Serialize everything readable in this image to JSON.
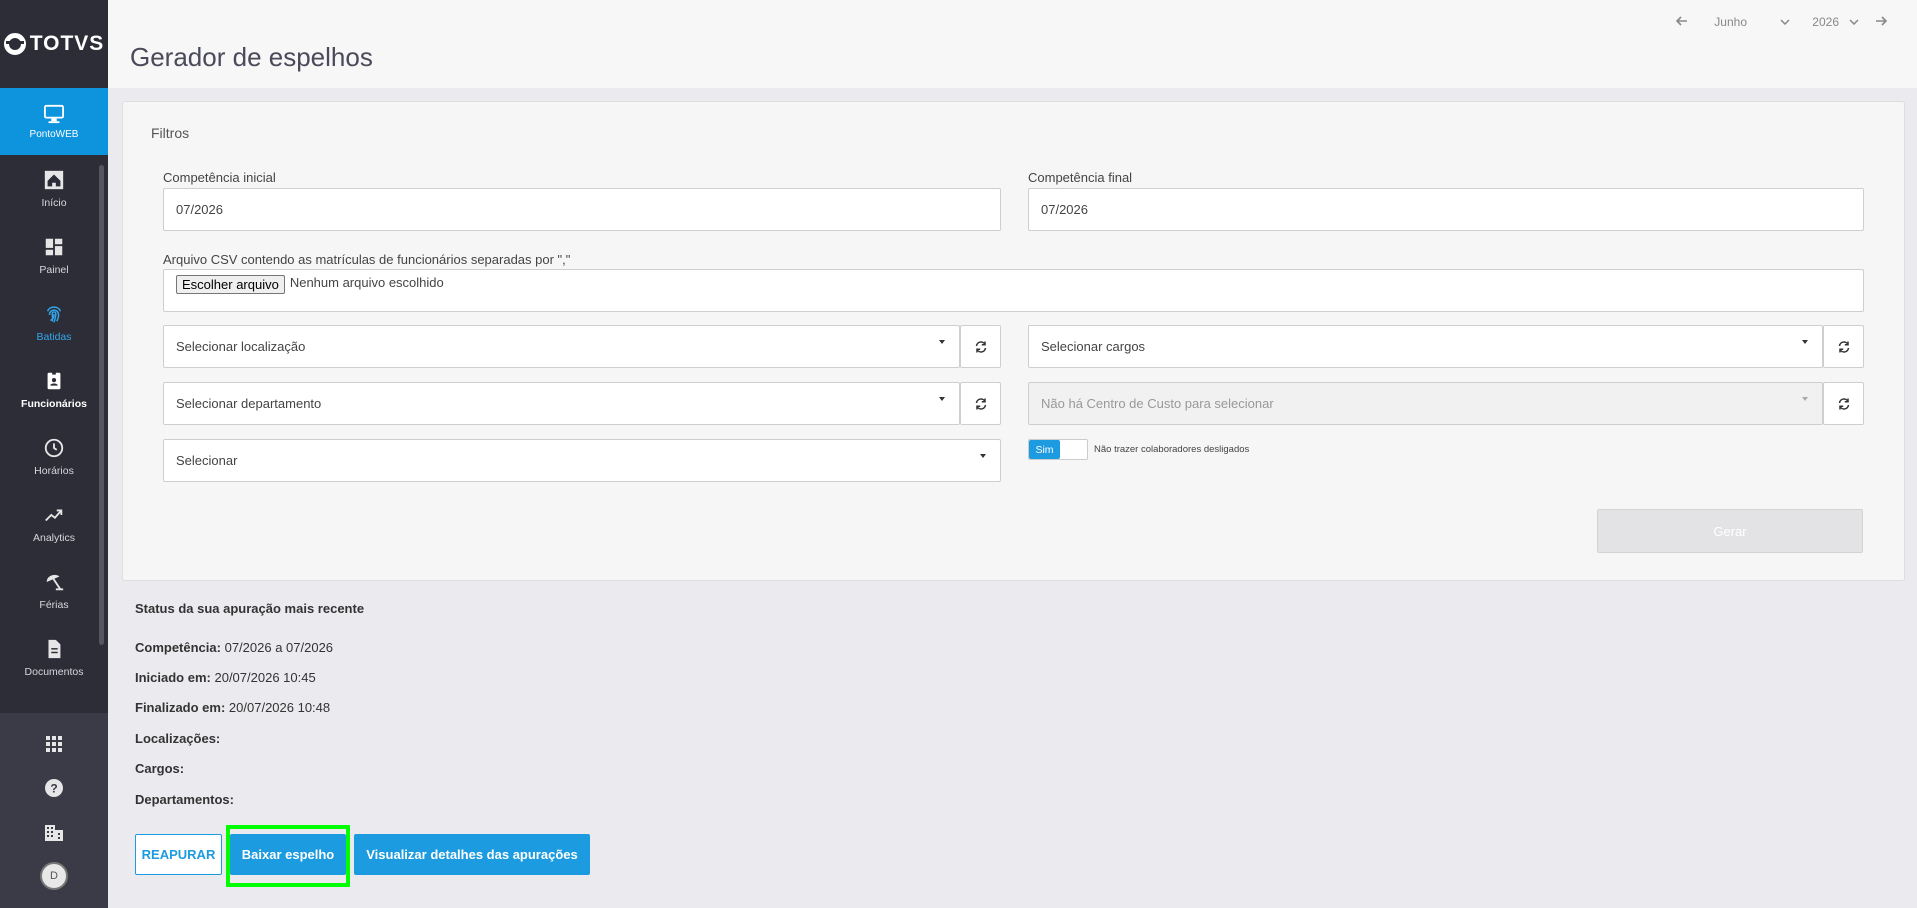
{
  "sidebar": {
    "logo": "TOTVS",
    "app_label": "PontoWEB",
    "items": [
      {
        "label": "Início",
        "icon": "home-icon"
      },
      {
        "label": "Painel",
        "icon": "dashboard-icon"
      },
      {
        "label": "Batidas",
        "icon": "fingerprint-icon"
      },
      {
        "label": "Funcionários",
        "icon": "badge-icon"
      },
      {
        "label": "Horários",
        "icon": "clock-icon"
      },
      {
        "label": "Analytics",
        "icon": "trending-icon"
      },
      {
        "label": "Férias",
        "icon": "umbrella-icon"
      },
      {
        "label": "Documentos",
        "icon": "document-icon"
      }
    ],
    "avatar": "D"
  },
  "header": {
    "title": "Gerador de espelhos",
    "month": "Junho",
    "year": "2026"
  },
  "filters": {
    "title": "Filtros",
    "comp_inicial_label": "Competência inicial",
    "comp_inicial_value": "07/2026",
    "comp_final_label": "Competência final",
    "comp_final_value": "07/2026",
    "csv_label": "Arquivo CSV contendo as matrículas de funcionários separadas por \",\"",
    "file_button": "Escolher arquivo",
    "file_status": "Nenhum arquivo escolhido",
    "localizacao": "Selecionar localização",
    "cargos": "Selecionar cargos",
    "departamento": "Selecionar departamento",
    "centro_custo": "Não há Centro de Custo para selecionar",
    "selecionar": "Selecionar",
    "toggle_on": "Sim",
    "toggle_label": "Não trazer colaboradores desligados",
    "gerar": "Gerar"
  },
  "status": {
    "title": "Status da sua apuração mais recente",
    "competencia_label": "Competência:",
    "competencia_value": "07/2026 a 07/2026",
    "iniciado_label": "Iniciado em:",
    "iniciado_value": "20/07/2026 10:45",
    "finalizado_label": "Finalizado em:",
    "finalizado_value": "20/07/2026 10:48",
    "localizacoes_label": "Localizações:",
    "cargos_label": "Cargos:",
    "departamentos_label": "Departamentos:"
  },
  "actions": {
    "reapurar": "REAPURAR",
    "baixar": "Baixar espelho",
    "visualizar": "Visualizar detalhes das apurações"
  },
  "colors": {
    "primary": "#1d9be0",
    "sidebar": "#2d2d38",
    "highlight": "#00ff00"
  }
}
